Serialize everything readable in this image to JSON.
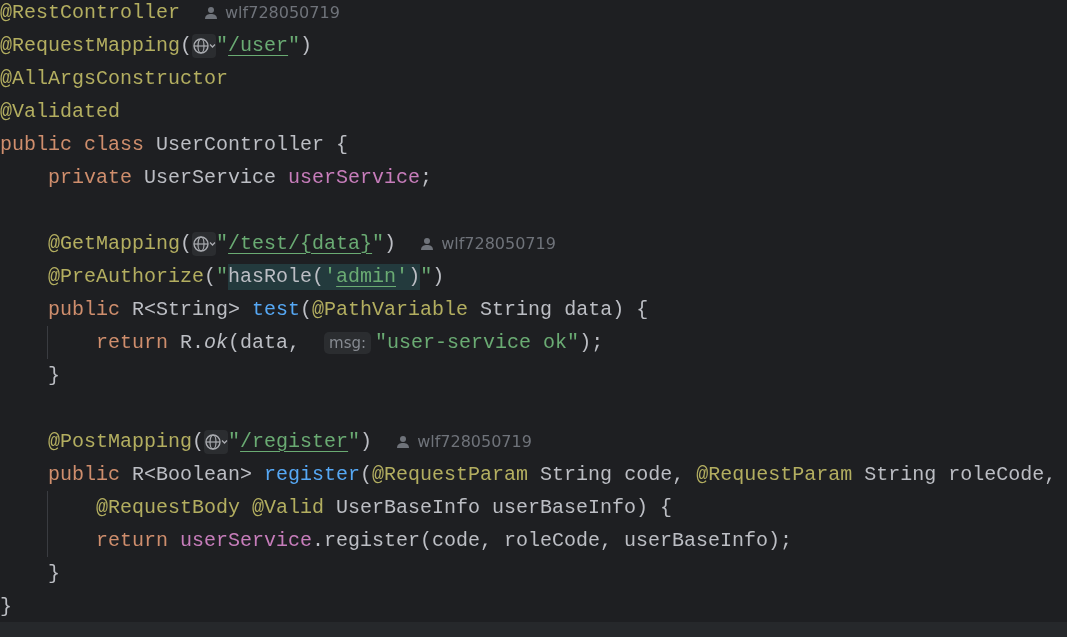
{
  "editor": {
    "lines": [
      {
        "kind": "code",
        "tokens": [
          {
            "kind": "annotation",
            "text": "@RestController"
          },
          {
            "kind": "author",
            "text": "wlf728050719"
          }
        ]
      },
      {
        "kind": "code",
        "tokens": [
          {
            "kind": "annotation",
            "text": "@RequestMapping"
          },
          {
            "kind": "plain",
            "text": "("
          },
          {
            "kind": "globe"
          },
          {
            "kind": "string",
            "text": "\""
          },
          {
            "kind": "link",
            "text": "/user"
          },
          {
            "kind": "string",
            "text": "\""
          },
          {
            "kind": "plain",
            "text": ")"
          }
        ]
      },
      {
        "kind": "code",
        "tokens": [
          {
            "kind": "annotation",
            "text": "@AllArgsConstructor"
          }
        ]
      },
      {
        "kind": "code",
        "tokens": [
          {
            "kind": "annotation",
            "text": "@Validated"
          }
        ]
      },
      {
        "kind": "code",
        "tokens": [
          {
            "kind": "keyword",
            "text": "public class "
          },
          {
            "kind": "plain",
            "text": "UserController {"
          }
        ],
        "children": [
          {
            "kind": "code",
            "tokens": [
              {
                "kind": "keyword",
                "text": "private "
              },
              {
                "kind": "plain",
                "text": "UserService "
              },
              {
                "kind": "field",
                "text": "userService"
              },
              {
                "kind": "plain",
                "text": ";"
              }
            ]
          },
          {
            "kind": "blank"
          },
          {
            "kind": "code",
            "tokens": [
              {
                "kind": "annotation",
                "text": "@GetMapping"
              },
              {
                "kind": "plain",
                "text": "("
              },
              {
                "kind": "globe"
              },
              {
                "kind": "string",
                "text": "\""
              },
              {
                "kind": "link",
                "text": "/test/{data}"
              },
              {
                "kind": "string",
                "text": "\""
              },
              {
                "kind": "plain",
                "text": ")"
              },
              {
                "kind": "author",
                "text": "wlf728050719"
              }
            ]
          },
          {
            "kind": "code",
            "tokens": [
              {
                "kind": "annotation",
                "text": "@PreAuthorize"
              },
              {
                "kind": "plain",
                "text": "("
              },
              {
                "kind": "string",
                "text": "\""
              },
              {
                "kind": "plain",
                "text": "hasRole(",
                "injected": true
              },
              {
                "kind": "string",
                "text": "'",
                "injected": true
              },
              {
                "kind": "link",
                "text": "admin",
                "injected": true
              },
              {
                "kind": "string",
                "text": "'",
                "injected": true
              },
              {
                "kind": "plain",
                "text": ")",
                "injected": true
              },
              {
                "kind": "string",
                "text": "\""
              },
              {
                "kind": "plain",
                "text": ")"
              }
            ]
          },
          {
            "kind": "code",
            "tokens": [
              {
                "kind": "keyword",
                "text": "public "
              },
              {
                "kind": "plain",
                "text": "R<String> "
              },
              {
                "kind": "method",
                "text": "test"
              },
              {
                "kind": "plain",
                "text": "("
              },
              {
                "kind": "annotation",
                "text": "@PathVariable"
              },
              {
                "kind": "plain",
                "text": " String data) {"
              }
            ],
            "children": [
              {
                "kind": "code",
                "tokens": [
                  {
                    "kind": "keyword",
                    "text": "return "
                  },
                  {
                    "kind": "plain",
                    "text": "R."
                  },
                  {
                    "kind": "static",
                    "text": "ok"
                  },
                  {
                    "kind": "plain",
                    "text": "(data, "
                  },
                  {
                    "kind": "hint",
                    "text": "msg:"
                  },
                  {
                    "kind": "string",
                    "text": "\"user-service ok\""
                  },
                  {
                    "kind": "plain",
                    "text": ");"
                  }
                ]
              }
            ]
          },
          {
            "kind": "code",
            "tokens": [
              {
                "kind": "plain",
                "text": "}"
              }
            ]
          },
          {
            "kind": "blank"
          },
          {
            "kind": "code",
            "tokens": [
              {
                "kind": "annotation",
                "text": "@PostMapping"
              },
              {
                "kind": "plain",
                "text": "("
              },
              {
                "kind": "globe"
              },
              {
                "kind": "string",
                "text": "\""
              },
              {
                "kind": "link",
                "text": "/register"
              },
              {
                "kind": "string",
                "text": "\""
              },
              {
                "kind": "plain",
                "text": ")"
              },
              {
                "kind": "author",
                "text": "wlf728050719"
              }
            ]
          },
          {
            "kind": "code",
            "tokens": [
              {
                "kind": "keyword",
                "text": "public "
              },
              {
                "kind": "plain",
                "text": "R<Boolean> "
              },
              {
                "kind": "method",
                "text": "register"
              },
              {
                "kind": "plain",
                "text": "("
              },
              {
                "kind": "annotation",
                "text": "@RequestParam"
              },
              {
                "kind": "plain",
                "text": " String code, "
              },
              {
                "kind": "annotation",
                "text": "@RequestParam"
              },
              {
                "kind": "plain",
                "text": " String roleCode,"
              }
            ],
            "children": [
              {
                "kind": "code",
                "tokens": [
                  {
                    "kind": "annotation",
                    "text": "@RequestBody @Valid"
                  },
                  {
                    "kind": "plain",
                    "text": " UserBaseInfo userBaseInfo) {"
                  }
                ]
              },
              {
                "kind": "code",
                "tokens": [
                  {
                    "kind": "keyword",
                    "text": "return "
                  },
                  {
                    "kind": "field",
                    "text": "userService"
                  },
                  {
                    "kind": "plain",
                    "text": ".register(code, roleCode, userBaseInfo);"
                  }
                ]
              }
            ]
          },
          {
            "kind": "code",
            "tokens": [
              {
                "kind": "plain",
                "text": "}"
              }
            ]
          }
        ]
      },
      {
        "kind": "code",
        "tokens": [
          {
            "kind": "plain",
            "text": "}"
          }
        ]
      }
    ]
  }
}
